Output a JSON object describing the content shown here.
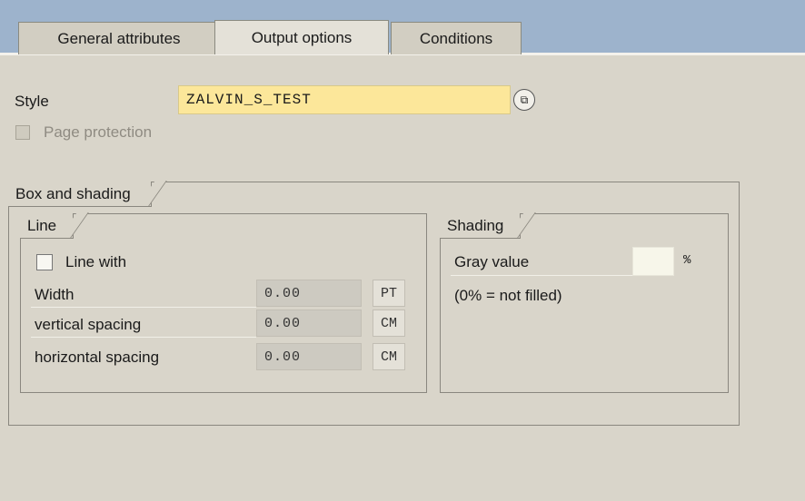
{
  "tabs": [
    {
      "label": "General attributes",
      "active": false
    },
    {
      "label": "Output options",
      "active": true
    },
    {
      "label": "Conditions",
      "active": false
    }
  ],
  "style": {
    "label": "Style",
    "value": "ZALVIN_S_TEST"
  },
  "page_protection": {
    "label": "Page protection",
    "checked": false,
    "disabled": true
  },
  "box_shading": {
    "title": "Box and shading",
    "line": {
      "title": "Line",
      "line_with_label": "Line with",
      "rows": [
        {
          "label": "Width",
          "value": "0.00",
          "unit": "PT"
        },
        {
          "label": "vertical spacing",
          "value": "0.00",
          "unit": "CM"
        },
        {
          "label": "horizontal spacing",
          "value": "0.00",
          "unit": "CM"
        }
      ]
    },
    "shading": {
      "title": "Shading",
      "gray_label": "Gray value",
      "gray_value": "",
      "percent": "%",
      "note": "(0% = not filled)"
    }
  },
  "colors": {
    "input_highlight": "#fce79a",
    "tab_strip": "#9db3cc",
    "background": "#d9d5ca"
  }
}
